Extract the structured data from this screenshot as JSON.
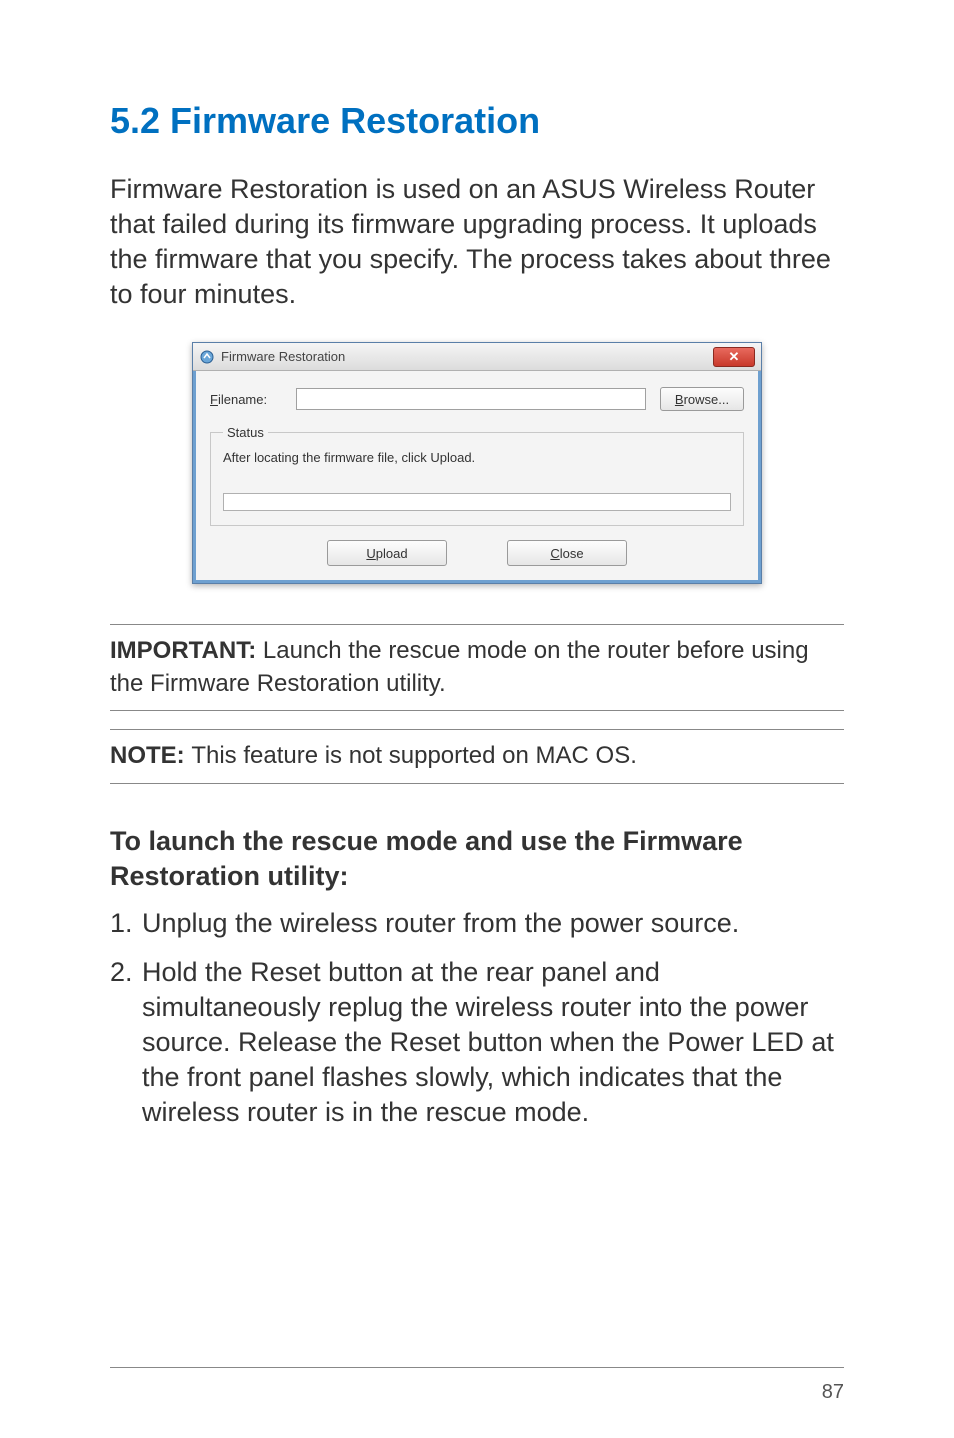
{
  "heading": "5.2   Firmware Restoration",
  "intro": "Firmware Restoration is used on an ASUS Wireless Router that failed during its firmware upgrading process. It uploads the firmware that you specify. The process takes about three to four minutes.",
  "dialog": {
    "title": "Firmware Restoration",
    "filename_label": "Filename:",
    "filename_value": "",
    "browse_label": "Browse...",
    "status_legend": "Status",
    "status_text": "After locating the firmware file, click Upload.",
    "upload_label": "Upload",
    "close_label": "Close",
    "close_x": "✕"
  },
  "important": {
    "label": "IMPORTANT:  ",
    "text": "Launch the rescue mode on the router before using the Firmware Restoration utility."
  },
  "note": {
    "label": "NOTE:  ",
    "text": "This feature is not supported on MAC OS."
  },
  "subheading": "To launch the rescue mode and use the Firmware Restoration utility:",
  "list": {
    "num1": "1.",
    "item1": "Unplug the wireless router from the power source.",
    "num2": "2.",
    "item2": "Hold the Reset button at the rear panel and simultaneously replug the wireless router into the power source. Release the Reset button when the Power LED at the front panel flashes slowly, which indicates that the wireless router is in the rescue mode."
  },
  "page_number": "87"
}
